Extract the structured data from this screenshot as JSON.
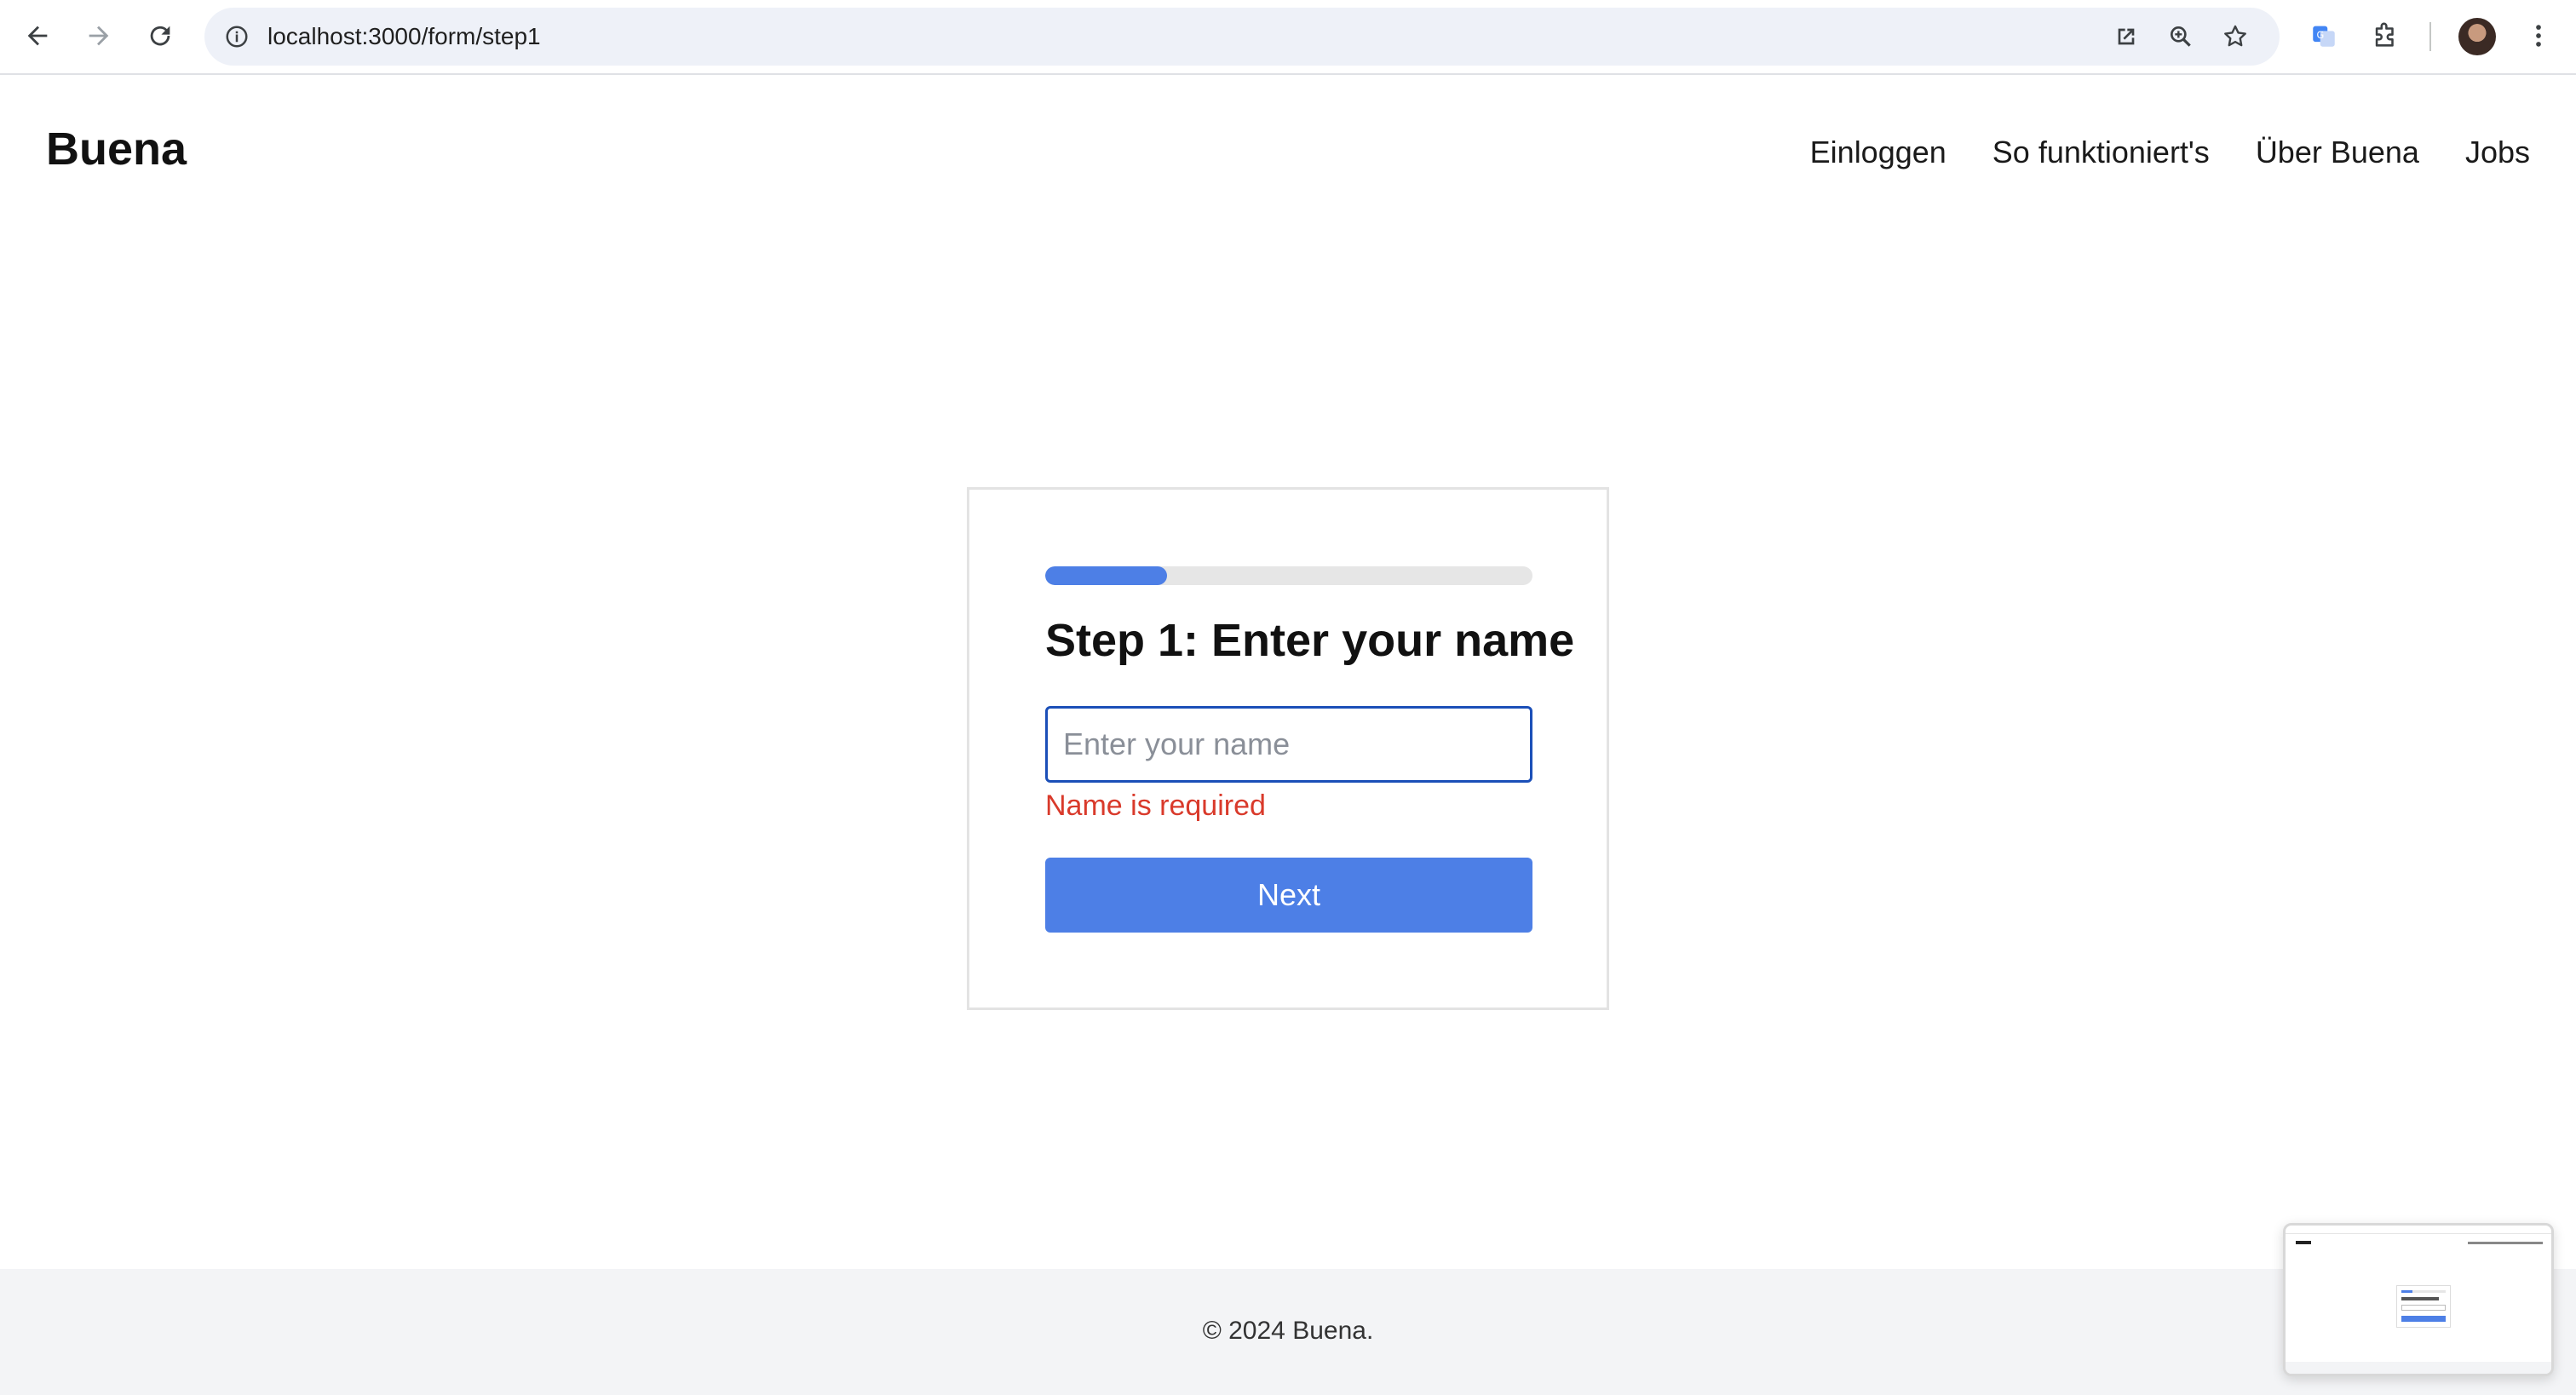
{
  "browser": {
    "url": "localhost:3000/form/step1",
    "icons": [
      "back-arrow-icon",
      "forward-arrow-icon",
      "reload-icon",
      "site-info-icon",
      "open-in-window-icon",
      "zoom-icon",
      "bookmark-star-icon",
      "translate-icon",
      "extensions-icon",
      "profile-avatar",
      "more-menu-icon"
    ]
  },
  "header": {
    "logo": "Buena",
    "nav": [
      {
        "label": "Einloggen"
      },
      {
        "label": "So funktioniert's"
      },
      {
        "label": "Über Buena"
      },
      {
        "label": "Jobs"
      }
    ]
  },
  "form": {
    "progress": 0.25,
    "title": "Step 1: Enter your name",
    "name_value": "",
    "name_placeholder": "Enter your name",
    "error": "Name is required",
    "next_label": "Next"
  },
  "footer": {
    "copyright": "© 2024 Buena."
  },
  "colors": {
    "accent": "#4d7fe6",
    "error": "#d93a2b",
    "focus_border": "#1b4fb8",
    "footer_bg": "#f3f4f6"
  }
}
